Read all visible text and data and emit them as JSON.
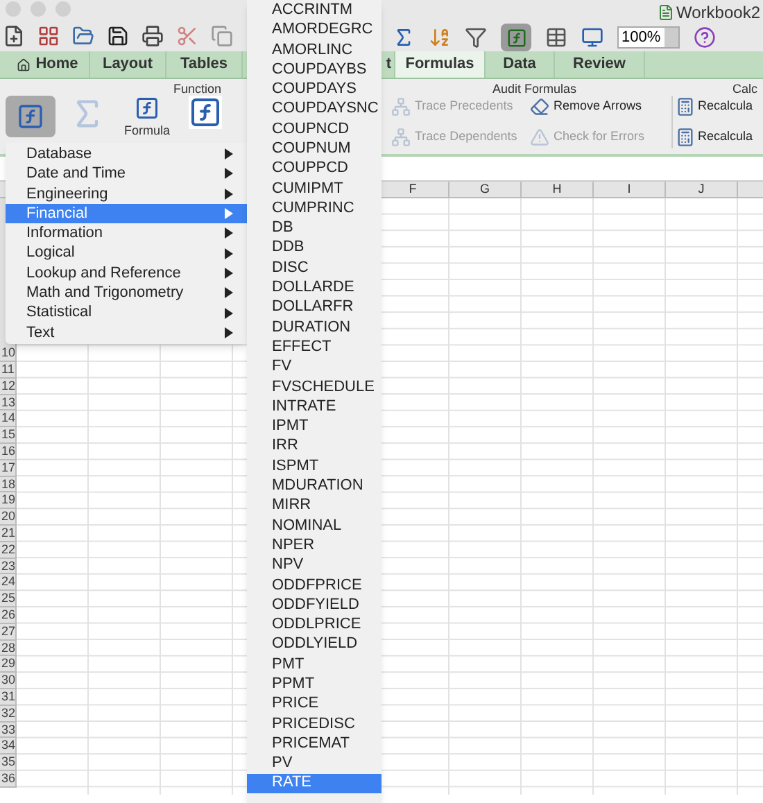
{
  "window": {
    "title": "Workbook2"
  },
  "toolbar": {
    "zoom": "100%"
  },
  "ribbon": {
    "tabs": [
      {
        "label": "Home",
        "selected": false
      },
      {
        "label": "Layout",
        "selected": false
      },
      {
        "label": "Tables",
        "selected": false
      },
      {
        "label": "t",
        "selected": false
      },
      {
        "label": "Formulas",
        "selected": true
      },
      {
        "label": "Data",
        "selected": false
      },
      {
        "label": "Review",
        "selected": false
      }
    ],
    "groups": [
      "Function",
      "Audit Formulas",
      "Calc"
    ],
    "formula_builder": {
      "label": "Formula"
    },
    "audit_buttons": [
      {
        "label": "Trace Precedents",
        "disabled": true
      },
      {
        "label": "Remove Arrows",
        "disabled": false
      },
      {
        "label": "Trace Dependents",
        "disabled": true
      },
      {
        "label": "Check for Errors",
        "disabled": true
      }
    ],
    "calc_buttons": [
      "Recalcula",
      "Recalcula"
    ]
  },
  "sheet": {
    "columns": [
      "F",
      "G",
      "H",
      "I",
      "J"
    ],
    "rows": [
      "10",
      "11",
      "12",
      "13",
      "14",
      "15",
      "16",
      "17",
      "18",
      "19",
      "20",
      "21",
      "22",
      "23",
      "24",
      "25",
      "26",
      "27",
      "28",
      "29",
      "30",
      "31",
      "32",
      "33",
      "34",
      "35",
      "36"
    ]
  },
  "category_menu": [
    {
      "label": "Database",
      "selected": false
    },
    {
      "label": "Date and Time",
      "selected": false
    },
    {
      "label": "Engineering",
      "selected": false
    },
    {
      "label": "Financial",
      "selected": true
    },
    {
      "label": "Information",
      "selected": false
    },
    {
      "label": "Logical",
      "selected": false
    },
    {
      "label": "Lookup and Reference",
      "selected": false
    },
    {
      "label": "Math and Trigonometry",
      "selected": false
    },
    {
      "label": "Statistical",
      "selected": false
    },
    {
      "label": "Text",
      "selected": false
    }
  ],
  "function_menu": [
    {
      "label": "ACCRINTM",
      "selected": false
    },
    {
      "label": "AMORDEGRC",
      "selected": false
    },
    {
      "label": "AMORLINC",
      "selected": false
    },
    {
      "label": "COUPDAYBS",
      "selected": false
    },
    {
      "label": "COUPDAYS",
      "selected": false
    },
    {
      "label": "COUPDAYSNC",
      "selected": false
    },
    {
      "label": "COUPNCD",
      "selected": false
    },
    {
      "label": "COUPNUM",
      "selected": false
    },
    {
      "label": "COUPPCD",
      "selected": false
    },
    {
      "label": "CUMIPMT",
      "selected": false
    },
    {
      "label": "CUMPRINC",
      "selected": false
    },
    {
      "label": "DB",
      "selected": false
    },
    {
      "label": "DDB",
      "selected": false
    },
    {
      "label": "DISC",
      "selected": false
    },
    {
      "label": "DOLLARDE",
      "selected": false
    },
    {
      "label": "DOLLARFR",
      "selected": false
    },
    {
      "label": "DURATION",
      "selected": false
    },
    {
      "label": "EFFECT",
      "selected": false
    },
    {
      "label": "FV",
      "selected": false
    },
    {
      "label": "FVSCHEDULE",
      "selected": false
    },
    {
      "label": "INTRATE",
      "selected": false
    },
    {
      "label": "IPMT",
      "selected": false
    },
    {
      "label": "IRR",
      "selected": false
    },
    {
      "label": "ISPMT",
      "selected": false
    },
    {
      "label": "MDURATION",
      "selected": false
    },
    {
      "label": "MIRR",
      "selected": false
    },
    {
      "label": "NOMINAL",
      "selected": false
    },
    {
      "label": "NPER",
      "selected": false
    },
    {
      "label": "NPV",
      "selected": false
    },
    {
      "label": "ODDFPRICE",
      "selected": false
    },
    {
      "label": "ODDFYIELD",
      "selected": false
    },
    {
      "label": "ODDLPRICE",
      "selected": false
    },
    {
      "label": "ODDLYIELD",
      "selected": false
    },
    {
      "label": "PMT",
      "selected": false
    },
    {
      "label": "PPMT",
      "selected": false
    },
    {
      "label": "PRICE",
      "selected": false
    },
    {
      "label": "PRICEDISC",
      "selected": false
    },
    {
      "label": "PRICEMAT",
      "selected": false
    },
    {
      "label": "PV",
      "selected": false
    },
    {
      "label": "RATE",
      "selected": true
    }
  ]
}
